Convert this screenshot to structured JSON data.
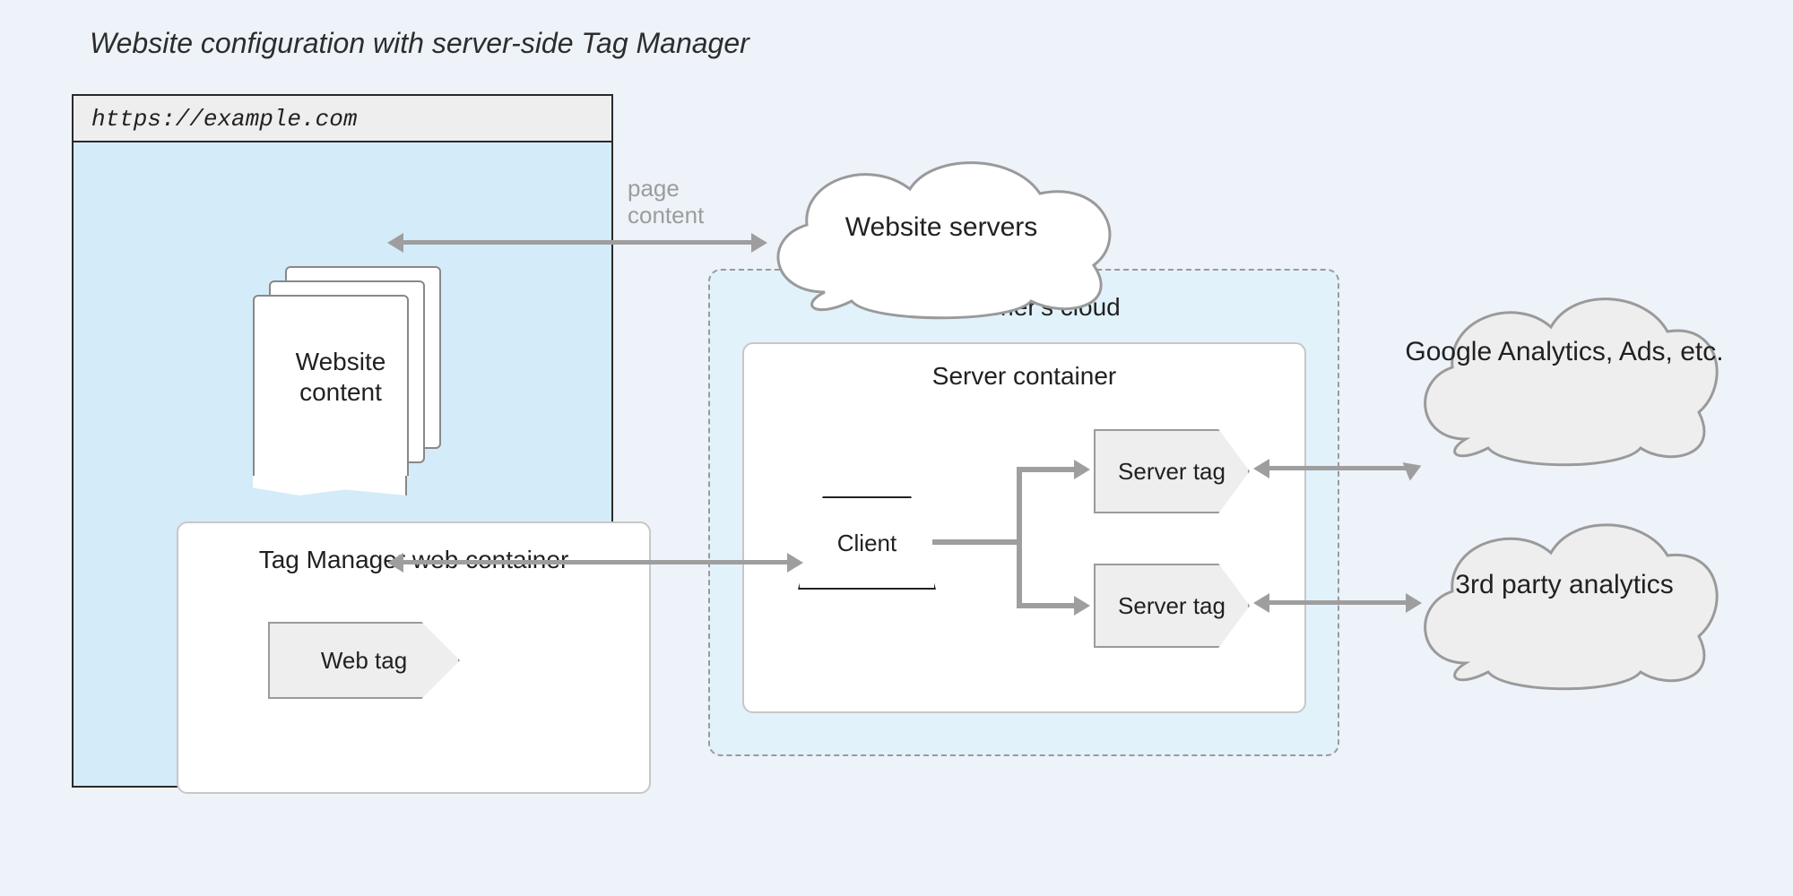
{
  "title": "Website configuration with server-side Tag Manager",
  "browser": {
    "url": "https://example.com",
    "content_label": "Website content",
    "web_container_label": "Tag Manager web container",
    "web_tag_label": "Web tag"
  },
  "arrows": {
    "page_content_label": "page\ncontent"
  },
  "website_servers_cloud": "Website servers",
  "customer_cloud": {
    "label": "Customer's cloud",
    "server_container_label": "Server container",
    "client_label": "Client",
    "server_tag_label": "Server tag"
  },
  "destinations": {
    "google": "Google Analytics, Ads, etc.",
    "third_party": "3rd party analytics"
  }
}
